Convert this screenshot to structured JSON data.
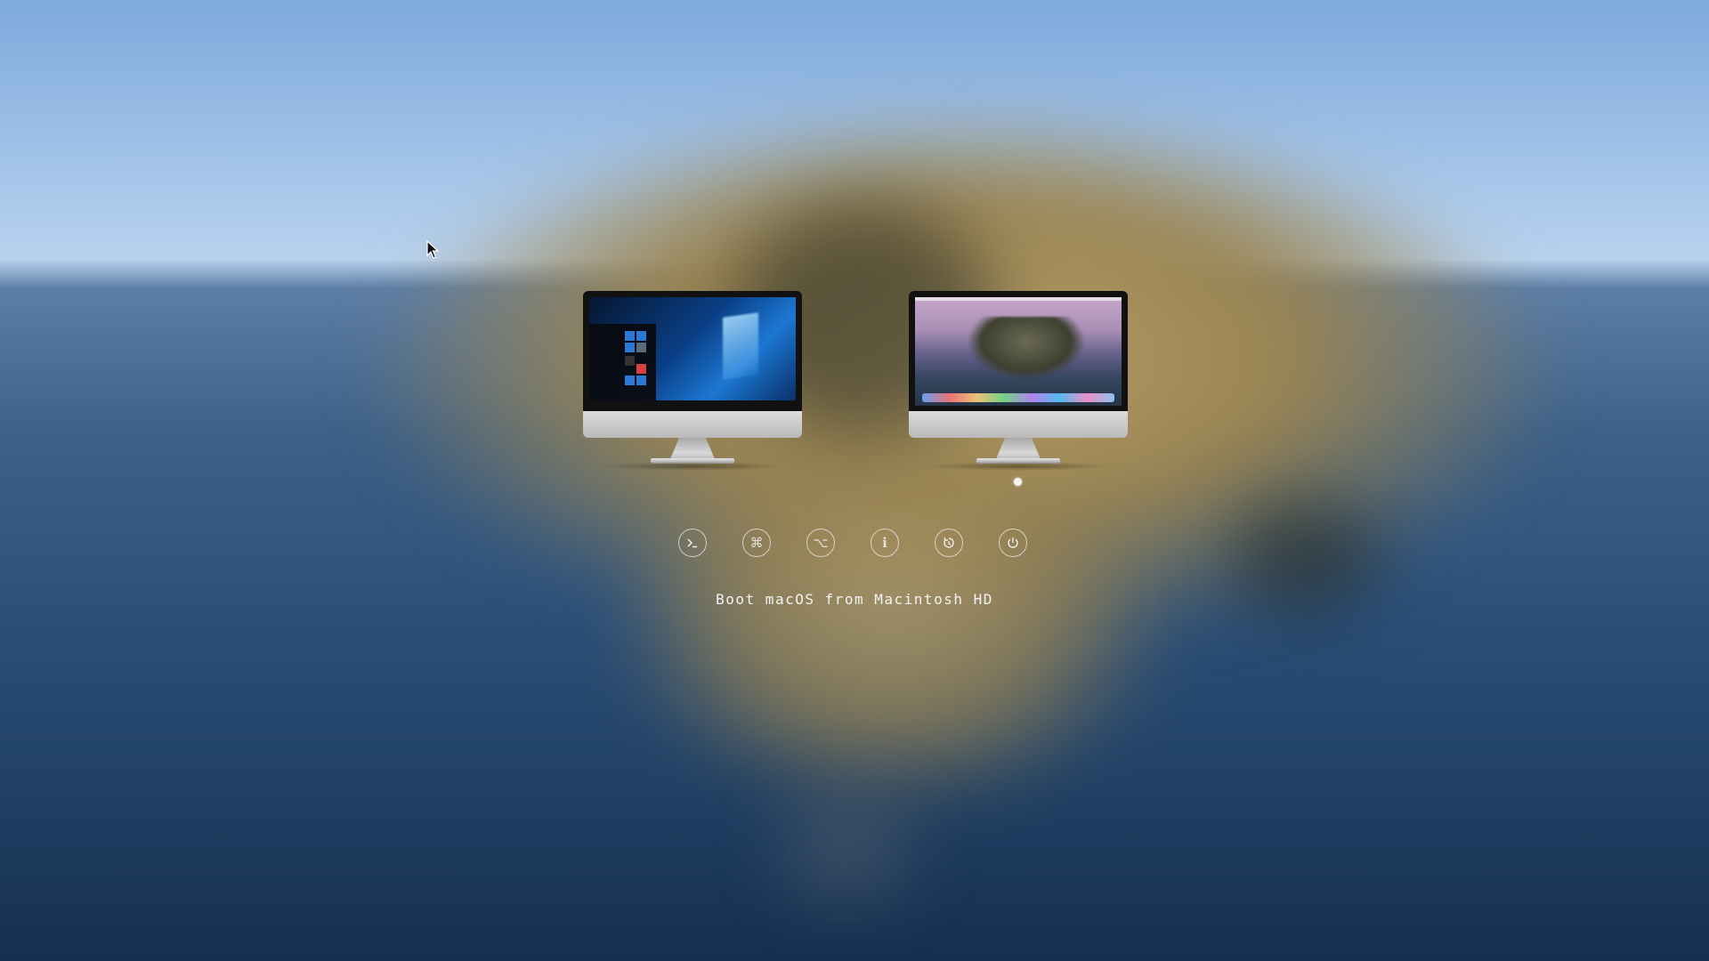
{
  "boot_entries": [
    {
      "name": "Windows",
      "screen": "windows-desktop",
      "selected": false
    },
    {
      "name": "macOS",
      "screen": "macos-catalina-desktop",
      "selected": true
    }
  ],
  "toolbar": {
    "buttons": [
      {
        "icon": "terminal-icon",
        "glyph": ">_"
      },
      {
        "icon": "command-icon",
        "glyph": "⌘"
      },
      {
        "icon": "option-icon",
        "glyph": "⌥"
      },
      {
        "icon": "info-icon",
        "glyph": "i"
      },
      {
        "icon": "restart-icon",
        "glyph": "↻"
      },
      {
        "icon": "power-icon",
        "glyph": "⏻"
      }
    ]
  },
  "status": {
    "label": "Boot macOS from Macintosh HD"
  },
  "colors": {
    "text": "#f2f2f2",
    "selection_dot": "#f4f4f4"
  }
}
